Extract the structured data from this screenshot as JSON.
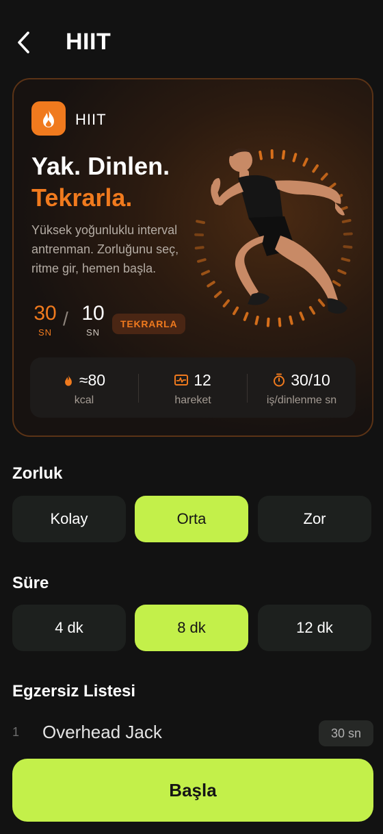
{
  "header": {
    "title": "HIIT",
    "back_icon": "chevron-left-icon"
  },
  "hero": {
    "badge_label": "HIIT",
    "badge_icon": "flame-icon",
    "headline_line1": "Yak. Dinlen.",
    "headline_line2": "Tekrarla.",
    "description": "Yüksek yoğunluklu interval antrenman. Zorluğunu seç, ritme gir, hemen başla.",
    "timer": {
      "work_value": "30",
      "work_unit": "SN",
      "separator": "/",
      "rest_value": "10",
      "rest_unit": "SN",
      "repeat_label": "TEKRARLA"
    },
    "stats": [
      {
        "icon": "flame-icon",
        "value": "≈80",
        "label": "kcal"
      },
      {
        "icon": "activity-icon",
        "value": "12",
        "label": "hareket"
      },
      {
        "icon": "stopwatch-icon",
        "value": "30/10",
        "label": "iş/dinlenme sn"
      }
    ]
  },
  "difficulty": {
    "label": "Zorluk",
    "options": [
      "Kolay",
      "Orta",
      "Zor"
    ],
    "selected": "Orta"
  },
  "duration": {
    "label": "Süre",
    "options": [
      "4 dk",
      "8 dk",
      "12 dk"
    ],
    "selected": "8 dk"
  },
  "exercises": {
    "label": "Egzersiz Listesi",
    "items": [
      {
        "index": "1",
        "name": "Overhead Jack",
        "duration": "30 sn"
      }
    ]
  },
  "start_button": {
    "label": "Başla"
  },
  "colors": {
    "accent_orange": "#f07a1e",
    "accent_lime": "#c3f04a",
    "background": "#121212"
  }
}
